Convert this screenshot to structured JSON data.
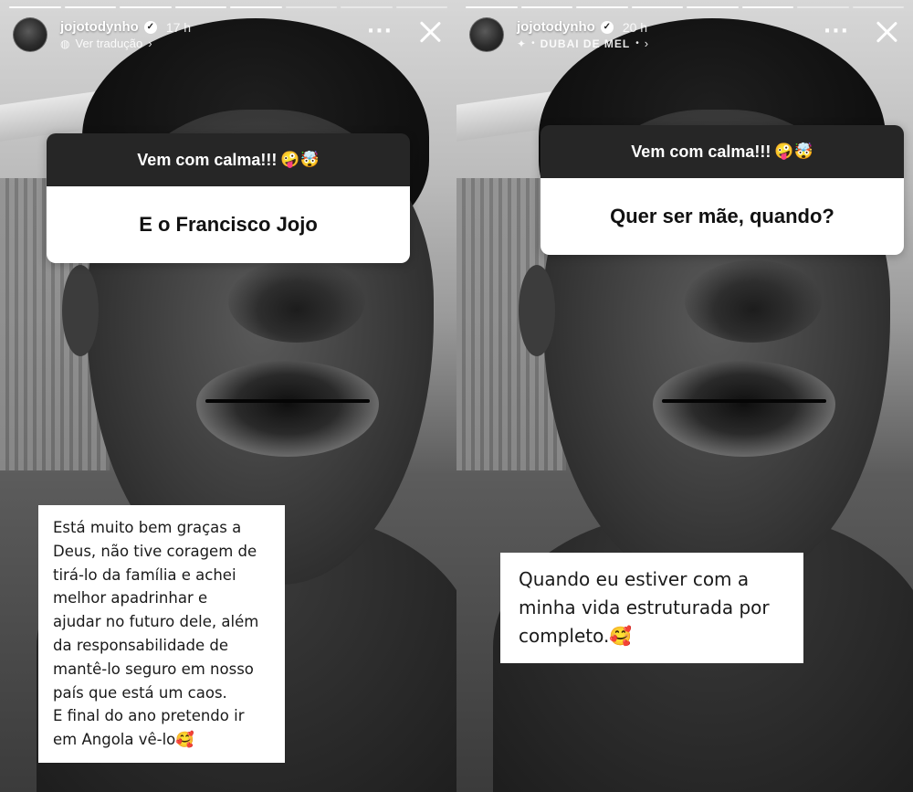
{
  "stories": [
    {
      "username": "jojotodynho",
      "time": "17 h",
      "subline_text": "Ver tradução",
      "sticker_title": "Vem com calma!!!",
      "sticker_emojis": "🤪🤯",
      "question": "E o Francisco Jojo",
      "answer": "Está muito bem graças a\nDeus, não tive coragem de\ntirá-lo da família e achei\nmelhor apadrinhar e\najudar no futuro dele, além\nda responsabilidade de\nmantê-lo seguro em nosso\npaís que está um caos.\nE final do ano pretendo ir\nem Angola vê-lo🥰"
    },
    {
      "username": "jojotodynho",
      "time": "20 h",
      "subline_text": "DUBAI DE MEL",
      "sticker_title": "Vem com calma!!!",
      "sticker_emojis": "🤪🤯",
      "question": "Quer ser mãe, quando?",
      "answer": "Quando eu estiver com a\nminha vida estruturada por\ncompleto.🥰"
    }
  ],
  "icons": {
    "verified": "verified-badge-icon",
    "translate": "translate-icon",
    "music": "sparkle-music-icon",
    "more": "more-options-icon",
    "close": "close-icon"
  }
}
